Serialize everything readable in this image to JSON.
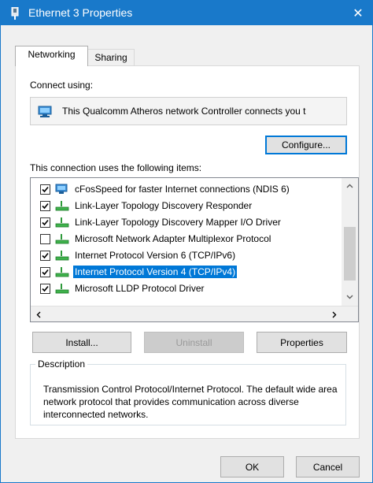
{
  "window": {
    "title": "Ethernet 3 Properties",
    "close_glyph": "✕",
    "accent_color": "#1979ca"
  },
  "tabs": [
    {
      "label": "Networking",
      "active": true
    },
    {
      "label": "Sharing",
      "active": false
    }
  ],
  "connect_using": {
    "label": "Connect using:",
    "adapter": "This Qualcomm Atheros network Controller connects you t",
    "adapter_icon": "network-adapter-icon"
  },
  "buttons": {
    "configure": "Configure...",
    "install": "Install...",
    "uninstall": "Uninstall",
    "properties": "Properties",
    "ok": "OK",
    "cancel": "Cancel"
  },
  "items_label": "This connection uses the following items:",
  "items": [
    {
      "name": "cFosSpeed for faster Internet connections (NDIS 6)",
      "checked": true,
      "icon": "cfos-adapter-icon",
      "selected": false
    },
    {
      "name": "Link-Layer Topology Discovery Responder",
      "checked": true,
      "icon": "protocol-icon",
      "selected": false
    },
    {
      "name": "Link-Layer Topology Discovery Mapper I/O Driver",
      "checked": true,
      "icon": "protocol-icon",
      "selected": false
    },
    {
      "name": "Microsoft Network Adapter Multiplexor Protocol",
      "checked": false,
      "icon": "protocol-icon",
      "selected": false
    },
    {
      "name": "Internet Protocol Version 6 (TCP/IPv6)",
      "checked": true,
      "icon": "protocol-icon",
      "selected": false
    },
    {
      "name": "Internet Protocol Version 4 (TCP/IPv4)",
      "checked": true,
      "icon": "protocol-icon",
      "selected": true
    },
    {
      "name": "Microsoft LLDP Protocol Driver",
      "checked": true,
      "icon": "protocol-icon",
      "selected": false
    }
  ],
  "description": {
    "legend": "Description",
    "text": "Transmission Control Protocol/Internet Protocol. The default wide area network protocol that provides communication across diverse interconnected networks."
  }
}
